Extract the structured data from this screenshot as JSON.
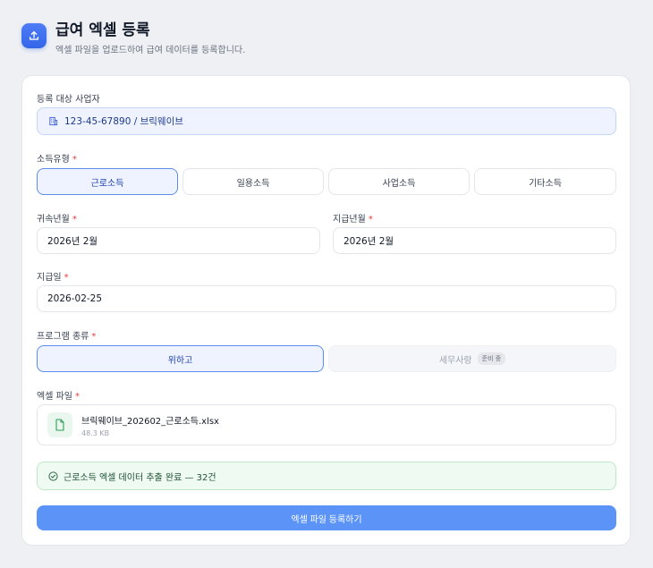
{
  "header": {
    "title": "급여 엑셀 등록",
    "subtitle": "엑셀 파일을 업로드하여 급여 데이터를 등록합니다."
  },
  "company": {
    "label": "등록 대상 사업자",
    "value": "123-45-67890 / 브릭웨이브"
  },
  "income_type": {
    "label": "소득유형",
    "required": "*",
    "options": [
      "근로소득",
      "일용소득",
      "사업소득",
      "기타소득"
    ],
    "selected": "근로소득"
  },
  "attribution_month": {
    "label": "귀속년월",
    "required": "*",
    "value": "2026년 2월"
  },
  "payment_month": {
    "label": "지급년월",
    "required": "*",
    "value": "2026년 2월"
  },
  "payment_date": {
    "label": "지급일",
    "required": "*",
    "value": "2026-02-25"
  },
  "program": {
    "label": "프로그램 종류",
    "required": "*",
    "options": [
      {
        "label": "위하고"
      },
      {
        "label": "세무사랑",
        "badge": "준비 중"
      }
    ],
    "selected": "위하고"
  },
  "excel_file": {
    "label": "엑셀 파일",
    "required": "*",
    "name": "브릭웨이브_202602_근로소득.xlsx",
    "size": "48.3 KB"
  },
  "status": {
    "message": "근로소득 엑셀 데이터 추출 완료 — 32건"
  },
  "submit": {
    "label": "엑셀 파일 등록하기"
  },
  "colors": {
    "accent": "#5b8def",
    "submit": "#5b93f6",
    "success_bg": "#effaf2",
    "required": "#e53e3e"
  },
  "icons": {
    "header": "upload-icon",
    "company": "building-icon",
    "file": "document-icon",
    "status": "check-circle-icon"
  }
}
